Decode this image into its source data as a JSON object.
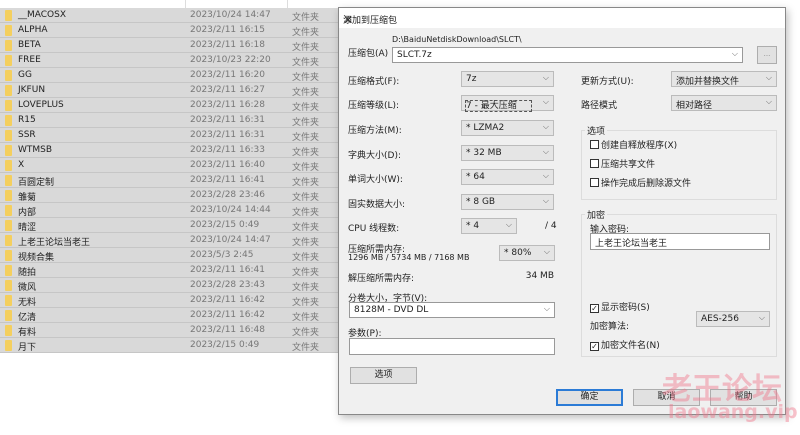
{
  "files": [
    {
      "name": "__MACOSX",
      "date": "2023/10/24 14:47",
      "type": "文件夹"
    },
    {
      "name": "ALPHA",
      "date": "2023/2/11 16:15",
      "type": "文件夹"
    },
    {
      "name": "BETA",
      "date": "2023/2/11 16:18",
      "type": "文件夹"
    },
    {
      "name": "FREE",
      "date": "2023/10/23 22:20",
      "type": "文件夹"
    },
    {
      "name": "GG",
      "date": "2023/2/11 16:20",
      "type": "文件夹"
    },
    {
      "name": "JKFUN",
      "date": "2023/2/11 16:27",
      "type": "文件夹"
    },
    {
      "name": "LOVEPLUS",
      "date": "2023/2/11 16:28",
      "type": "文件夹"
    },
    {
      "name": "R15",
      "date": "2023/2/11 16:31",
      "type": "文件夹"
    },
    {
      "name": "SSR",
      "date": "2023/2/11 16:31",
      "type": "文件夹"
    },
    {
      "name": "WTMSB",
      "date": "2023/2/11 16:33",
      "type": "文件夹"
    },
    {
      "name": "X",
      "date": "2023/2/11 16:40",
      "type": "文件夹"
    },
    {
      "name": "百圆定制",
      "date": "2023/2/11 16:41",
      "type": "文件夹"
    },
    {
      "name": "雏菊",
      "date": "2023/2/28 23:46",
      "type": "文件夹"
    },
    {
      "name": "内部",
      "date": "2023/10/24 14:44",
      "type": "文件夹"
    },
    {
      "name": "晴涩",
      "date": "2023/2/15 0:49",
      "type": "文件夹"
    },
    {
      "name": "上老王论坛当老王",
      "date": "2023/10/24 14:47",
      "type": "文件夹"
    },
    {
      "name": "视频合集",
      "date": "2023/5/3 2:45",
      "type": "文件夹"
    },
    {
      "name": "随拍",
      "date": "2023/2/11 16:41",
      "type": "文件夹"
    },
    {
      "name": "微风",
      "date": "2023/2/28 23:43",
      "type": "文件夹"
    },
    {
      "name": "无料",
      "date": "2023/2/11 16:42",
      "type": "文件夹"
    },
    {
      "name": "亿清",
      "date": "2023/2/11 16:42",
      "type": "文件夹"
    },
    {
      "name": "有料",
      "date": "2023/2/11 16:48",
      "type": "文件夹"
    },
    {
      "name": "月下",
      "date": "2023/2/15 0:49",
      "type": "文件夹"
    }
  ],
  "dialog": {
    "title": "添加到压缩包",
    "archive_label": "压缩包(A)",
    "archive_path": "D:\\BaiduNetdiskDownload\\SLCT\\",
    "archive_name": "SLCT.7z",
    "browse_label": "...",
    "left": {
      "format_label": "压缩格式(F):",
      "format": "7z",
      "level_label": "压缩等级(L):",
      "level": "7 - 最大压缩",
      "method_label": "压缩方法(M):",
      "method": "* LZMA2",
      "dict_label": "字典大小(D):",
      "dict": "* 32 MB",
      "word_label": "单词大小(W):",
      "word": "* 64",
      "solid_label": "固实数据大小:",
      "solid": "* 8 GB",
      "cpu_label": "CPU 线程数:",
      "cpu": "* 4",
      "cpu_max": "/ 4",
      "mem_label": "压缩所需内存:",
      "mem_values": "1296 MB / 5734 MB / 7168 MB",
      "mem_percent": "* 80%",
      "decomp_label": "解压缩所需内存:",
      "decomp_value": "34 MB",
      "volume_label": "分卷大小，字节(V):",
      "volume": "8128M - DVD DL",
      "params_label": "参数(P):",
      "params": "",
      "options_button": "选项"
    },
    "right": {
      "update_label": "更新方式(U):",
      "update": "添加并替换文件",
      "path_label": "路径模式",
      "path": "相对路径",
      "options_group": "选项",
      "options": [
        {
          "label": "创建自释放程序(X)",
          "checked": false
        },
        {
          "label": "压缩共享文件",
          "checked": false
        },
        {
          "label": "操作完成后删除源文件",
          "checked": false
        }
      ],
      "encrypt_group": "加密",
      "password_label": "输入密码:",
      "password": "上老王论坛当老王",
      "show_password": {
        "label": "显示密码(S)",
        "checked": true
      },
      "algo_label": "加密算法:",
      "algo": "AES-256",
      "encrypt_names": {
        "label": "加密文件名(N)",
        "checked": true
      }
    },
    "ok": "确定",
    "cancel": "取消",
    "help": "帮助"
  },
  "watermark": {
    "line1": "老王论坛",
    "line2": "laowang.vip"
  }
}
